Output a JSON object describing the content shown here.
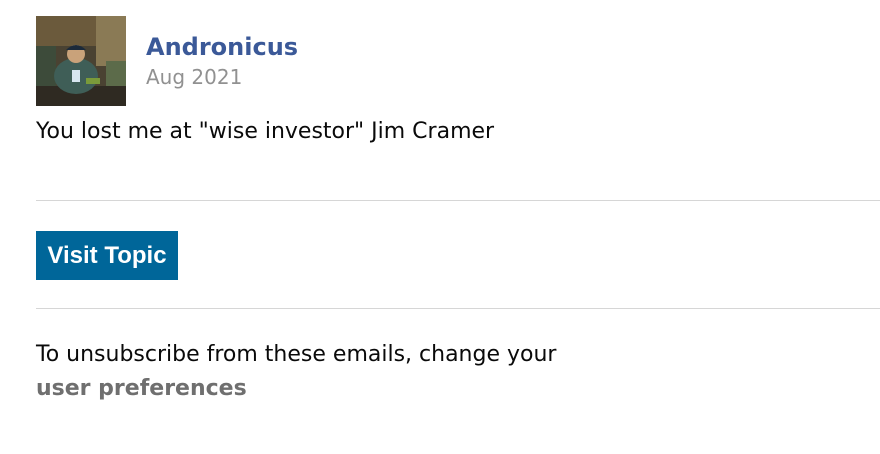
{
  "post": {
    "author": "Andronicus",
    "date": "Aug 2021",
    "body": "You lost me at \"wise investor\" Jim Cramer"
  },
  "actions": {
    "visit_topic_label": "Visit Topic"
  },
  "footer": {
    "unsubscribe_text": "To unsubscribe from these emails, change your",
    "preferences_link": "user preferences"
  },
  "colors": {
    "author_link": "#3b5998",
    "date_text": "#919191",
    "button_bg": "#006699",
    "button_text": "#ffffff",
    "footer_link": "#6f6f6f",
    "divider": "#d6d6d6"
  }
}
